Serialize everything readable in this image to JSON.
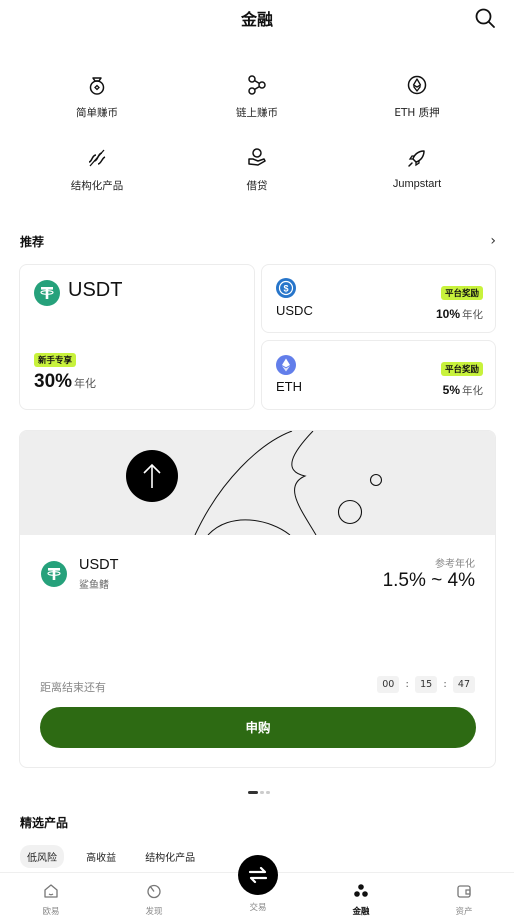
{
  "header": {
    "title": "金融"
  },
  "menu": [
    {
      "label": "简单赚币",
      "icon": "coin-bag-icon"
    },
    {
      "label": "链上赚币",
      "icon": "nodes-icon"
    },
    {
      "label": "ETH 质押",
      "icon": "ethereum-icon"
    },
    {
      "label": "结构化产品",
      "icon": "structured-icon"
    },
    {
      "label": "借贷",
      "icon": "loan-hand-icon"
    },
    {
      "label": "Jumpstart",
      "icon": "rocket-icon"
    }
  ],
  "recommend": {
    "title": "推荐",
    "usdt": {
      "name": "USDT",
      "badge": "新手专享",
      "rate": "30%",
      "unit": "年化"
    },
    "usdc": {
      "name": "USDC",
      "badge": "平台奖励",
      "rate": "10%",
      "unit": "年化"
    },
    "eth": {
      "name": "ETH",
      "badge": "平台奖励",
      "rate": "5%",
      "unit": "年化"
    }
  },
  "banner": {
    "coin": "USDT",
    "subtitle": "鲨鱼鳍",
    "ref_label": "参考年化",
    "range": "1.5% ~ 4%",
    "countdown_label": "距离结束还有",
    "timer": [
      "00",
      "15",
      "47"
    ],
    "button": "申购"
  },
  "featured": {
    "title": "精选产品",
    "chips": [
      "低风险",
      "高收益",
      "结构化产品"
    ]
  },
  "tabs": [
    {
      "label": "欧易",
      "icon": "home-icon"
    },
    {
      "label": "发现",
      "icon": "discover-icon"
    },
    {
      "label": "交易",
      "icon": "swap-icon"
    },
    {
      "label": "金融",
      "icon": "finance-icon"
    },
    {
      "label": "资产",
      "icon": "wallet-icon"
    }
  ],
  "colors": {
    "accent_green": "#2d6a13",
    "lime_badge": "#c8f23c",
    "tether": "#26a17b",
    "usdc": "#2775ca",
    "eth": "#627eea"
  }
}
